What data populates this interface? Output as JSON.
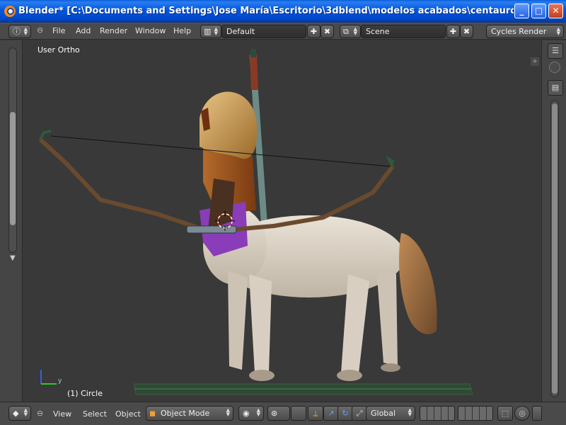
{
  "window": {
    "title": "Blender* [C:\\Documents and Settings\\Jose María\\Escritorio\\3dblend\\modelos acabados\\centauro\\DEFINITIVOS\\...",
    "minimize": "_",
    "maximize": "□",
    "close": "✕"
  },
  "header": {
    "menus": [
      "File",
      "Add",
      "Render",
      "Window",
      "Help"
    ],
    "layout_name": "Default",
    "scene_name": "Scene",
    "render_engine": "Cycles Render"
  },
  "viewport": {
    "view_label": "User Ortho",
    "object_label": "(1) Circle",
    "axis_y": "y"
  },
  "footer": {
    "menus": [
      "View",
      "Select",
      "Object"
    ],
    "mode": "Object Mode",
    "orientation": "Global"
  },
  "colors": {
    "viewport_bg": "#393939",
    "header_bg": "#4a4a4a",
    "xp_title": "#0058e0"
  },
  "icons": [
    "blender-logo-icon",
    "editor-type-icon",
    "layout-icon",
    "scene-icon",
    "add-icon",
    "close-icon",
    "shading-icon",
    "pivot-icon",
    "manipulator-icon",
    "layers-icon",
    "lock-icon",
    "render-icon"
  ]
}
